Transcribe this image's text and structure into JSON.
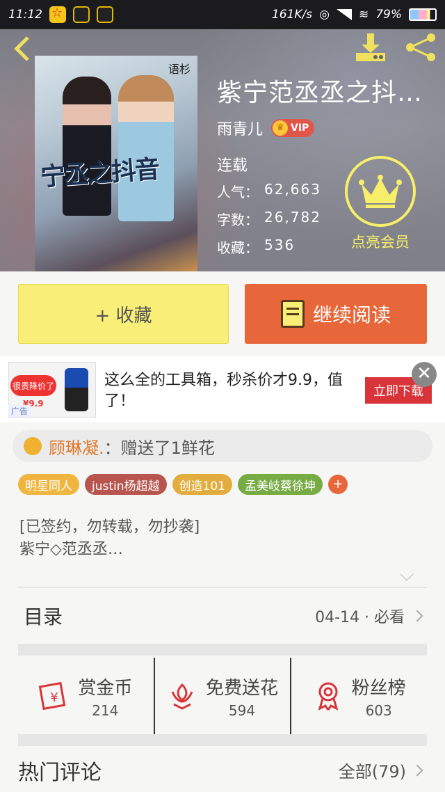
{
  "status_bar": {
    "time": "11:12",
    "network_speed": "161K/s",
    "battery": "79%"
  },
  "book": {
    "title": "紫宁范丞丞之抖音…",
    "author": "雨青儿",
    "vip_label": "VIP",
    "status": "连载",
    "cover_title": "宁丞之抖音",
    "cover_brand": "语杉",
    "stats": [
      {
        "label": "人气：",
        "value": "62,663"
      },
      {
        "label": "字数：",
        "value": "26,782"
      },
      {
        "label": "收藏：",
        "value": "536"
      }
    ]
  },
  "member": {
    "label": "点亮会员"
  },
  "actions": {
    "favorite_label": "+ 收藏",
    "read_label": "继续阅读"
  },
  "ad": {
    "text": "这么全的工具箱，秒杀价才9.9，值了！",
    "cta": "立即下载",
    "label": "广告",
    "image_tag": "很贵降价了",
    "image_price": "¥9.9"
  },
  "gift": {
    "user": "顾琳凝.",
    "action": "：赠送了1鲜花"
  },
  "tags": [
    "明星同人",
    "justin杨超越",
    "创造101",
    "孟美岐蔡徐坤"
  ],
  "description": {
    "line1": "[已签约，勿转载，勿抄袭]",
    "line2": "紫宁◇范丞丞…"
  },
  "toc": {
    "title": "目录",
    "update": "04-14 · 必看"
  },
  "support": [
    {
      "label": "赏金币",
      "count": "214",
      "icon": "reward-coin-icon"
    },
    {
      "label": "免费送花",
      "count": "594",
      "icon": "flower-icon"
    },
    {
      "label": "粉丝榜",
      "count": "603",
      "icon": "medal-icon"
    }
  ],
  "comments": {
    "title": "热门评论",
    "all_label": "全部(79)"
  },
  "colors": {
    "accent_yellow": "#f8ee78",
    "accent_orange": "#e8673a"
  }
}
